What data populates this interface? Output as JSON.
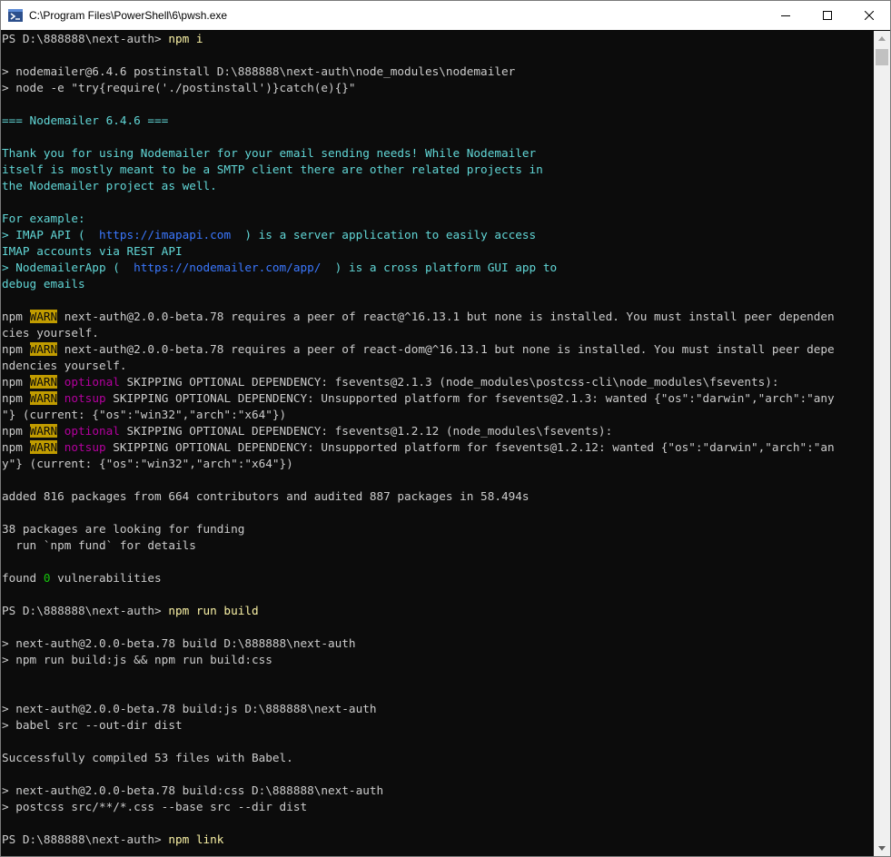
{
  "window": {
    "title": "C:\\Program Files\\PowerShell\\6\\pwsh.exe"
  },
  "icons": {
    "app": "powershell-icon",
    "minimize": "minimize-icon",
    "maximize": "maximize-icon",
    "close": "close-icon",
    "scroll_up": "scroll-up-arrow-icon",
    "scroll_down": "scroll-down-arrow-icon"
  },
  "colors": {
    "background": "#0c0c0c",
    "text": "#cccccc",
    "command": "#f9f1a5",
    "nodemailer": "#61d6d6",
    "link": "#3b78ff",
    "warn_badge": "#c19c00",
    "optional": "#b4009e",
    "zero": "#16c60c"
  },
  "terminal": {
    "lines": [
      [
        {
          "t": "PS D:\\888888\\next-auth> "
        },
        {
          "t": "npm i",
          "c": "yellow"
        }
      ],
      [],
      [
        {
          "t": "> nodemailer@6.4.6 postinstall D:\\888888\\next-auth\\node_modules\\nodemailer"
        }
      ],
      [
        {
          "t": "> node -e \"try{require('./postinstall')}catch(e){}\""
        }
      ],
      [],
      [
        {
          "t": "=== Nodemailer 6.4.6 ===",
          "c": "cyan"
        }
      ],
      [],
      [
        {
          "t": "Thank you for using Nodemailer for your email sending needs! While Nodemailer",
          "c": "cyan"
        }
      ],
      [
        {
          "t": "itself is mostly meant to be a SMTP client there are other related projects in",
          "c": "cyan"
        }
      ],
      [
        {
          "t": "the Nodemailer project as well.",
          "c": "cyan"
        }
      ],
      [],
      [
        {
          "t": "For example:",
          "c": "cyan"
        }
      ],
      [
        {
          "t": "> IMAP API ( ",
          "c": "cyan"
        },
        {
          "t": " https://imapapi.com ",
          "c": "blue"
        },
        {
          "t": " ) is a server application to easily access",
          "c": "cyan"
        }
      ],
      [
        {
          "t": "IMAP accounts via REST API",
          "c": "cyan"
        }
      ],
      [
        {
          "t": "> NodemailerApp ( ",
          "c": "cyan"
        },
        {
          "t": " https://nodemailer.com/app/ ",
          "c": "blue"
        },
        {
          "t": " ) is a cross platform GUI app to",
          "c": "cyan"
        }
      ],
      [
        {
          "t": "debug emails",
          "c": "cyan"
        }
      ],
      [],
      [
        {
          "t": "npm "
        },
        {
          "t": "WARN",
          "c": "warn"
        },
        {
          "t": " next-auth@2.0.0-beta.78 requires a peer of react@^16.13.1 but none is installed. You must install peer dependen"
        }
      ],
      [
        {
          "t": "cies yourself."
        }
      ],
      [
        {
          "t": "npm "
        },
        {
          "t": "WARN",
          "c": "warn"
        },
        {
          "t": " next-auth@2.0.0-beta.78 requires a peer of react-dom@^16.13.1 but none is installed. You must install peer depe"
        }
      ],
      [
        {
          "t": "ndencies yourself."
        }
      ],
      [
        {
          "t": "npm "
        },
        {
          "t": "WARN",
          "c": "warn"
        },
        {
          "t": " "
        },
        {
          "t": "optional",
          "c": "magenta"
        },
        {
          "t": " SKIPPING OPTIONAL DEPENDENCY: fsevents@2.1.3 (node_modules\\postcss-cli\\node_modules\\fsevents):"
        }
      ],
      [
        {
          "t": "npm "
        },
        {
          "t": "WARN",
          "c": "warn"
        },
        {
          "t": " "
        },
        {
          "t": "notsup",
          "c": "magenta"
        },
        {
          "t": " SKIPPING OPTIONAL DEPENDENCY: Unsupported platform for fsevents@2.1.3: wanted {\"os\":\"darwin\",\"arch\":\"any"
        }
      ],
      [
        {
          "t": "\"} (current: {\"os\":\"win32\",\"arch\":\"x64\"})"
        }
      ],
      [
        {
          "t": "npm "
        },
        {
          "t": "WARN",
          "c": "warn"
        },
        {
          "t": " "
        },
        {
          "t": "optional",
          "c": "magenta"
        },
        {
          "t": " SKIPPING OPTIONAL DEPENDENCY: fsevents@1.2.12 (node_modules\\fsevents):"
        }
      ],
      [
        {
          "t": "npm "
        },
        {
          "t": "WARN",
          "c": "warn"
        },
        {
          "t": " "
        },
        {
          "t": "notsup",
          "c": "magenta"
        },
        {
          "t": " SKIPPING OPTIONAL DEPENDENCY: Unsupported platform for fsevents@1.2.12: wanted {\"os\":\"darwin\",\"arch\":\"an"
        }
      ],
      [
        {
          "t": "y\"} (current: {\"os\":\"win32\",\"arch\":\"x64\"})"
        }
      ],
      [],
      [
        {
          "t": "added 816 packages from 664 contributors and audited 887 packages in 58.494s"
        }
      ],
      [],
      [
        {
          "t": "38 packages are looking for funding"
        }
      ],
      [
        {
          "t": "  run `npm fund` for details"
        }
      ],
      [],
      [
        {
          "t": "found "
        },
        {
          "t": "0",
          "c": "green"
        },
        {
          "t": " vulnerabilities"
        }
      ],
      [],
      [
        {
          "t": "PS D:\\888888\\next-auth> "
        },
        {
          "t": "npm run build",
          "c": "yellow"
        }
      ],
      [],
      [
        {
          "t": "> next-auth@2.0.0-beta.78 build D:\\888888\\next-auth"
        }
      ],
      [
        {
          "t": "> npm run build:js && npm run build:css"
        }
      ],
      [],
      [],
      [
        {
          "t": "> next-auth@2.0.0-beta.78 build:js D:\\888888\\next-auth"
        }
      ],
      [
        {
          "t": "> babel src --out-dir dist"
        }
      ],
      [],
      [
        {
          "t": "Successfully compiled 53 files with Babel."
        }
      ],
      [],
      [
        {
          "t": "> next-auth@2.0.0-beta.78 build:css D:\\888888\\next-auth"
        }
      ],
      [
        {
          "t": "> postcss src/**/*.css --base src --dir dist"
        }
      ],
      [],
      [
        {
          "t": "PS D:\\888888\\next-auth> "
        },
        {
          "t": "npm link",
          "c": "yellow"
        }
      ]
    ]
  }
}
